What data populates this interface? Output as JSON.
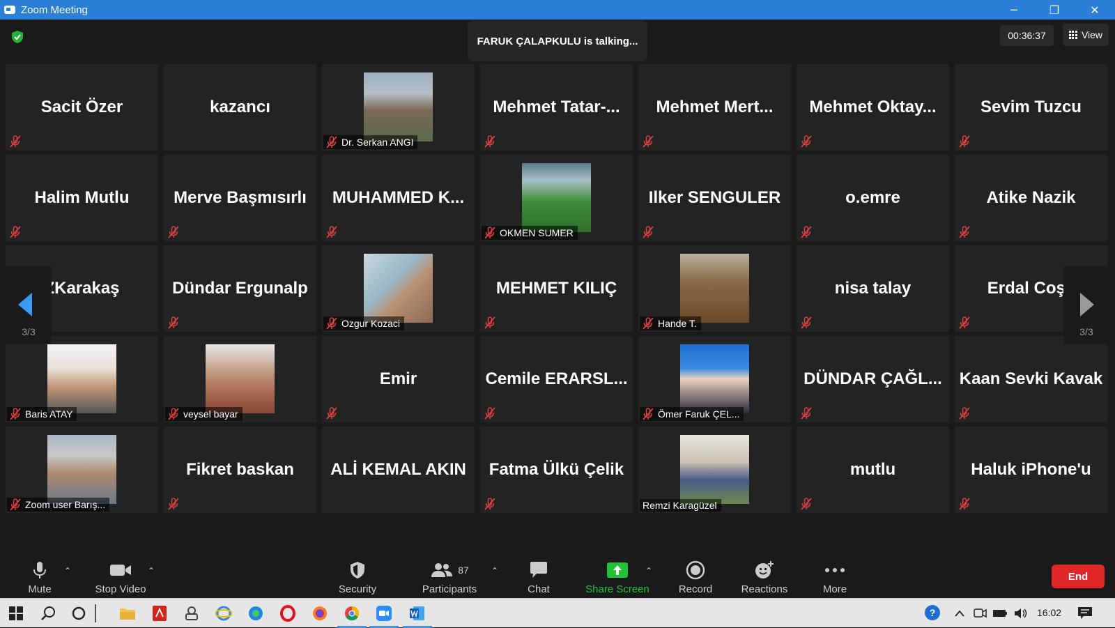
{
  "window": {
    "title": "Zoom Meeting",
    "minimize": "─",
    "restore": "❐",
    "close": "✕"
  },
  "meeting": {
    "talking_banner": "FARUK ÇALAPKULU is talking...",
    "timer": "00:36:37",
    "view_label": "View"
  },
  "participants": [
    {
      "name": "Sacit Özer",
      "video": false
    },
    {
      "name": "kazancı",
      "video": false,
      "muted": false
    },
    {
      "name": "Dr. Serkan ANGI",
      "video": true,
      "photo": "cap-sunglasses"
    },
    {
      "name": "Mehmet  Tatar-...",
      "video": false
    },
    {
      "name": "Mehmet  Mert...",
      "video": false
    },
    {
      "name": "Mehmet  Oktay...",
      "video": false
    },
    {
      "name": "Sevim Tuzcu",
      "video": false
    },
    {
      "name": "Halim Mutlu",
      "video": false
    },
    {
      "name": "Merve Başmısırlı",
      "video": false
    },
    {
      "name": "MUHAMMED  K...",
      "video": false
    },
    {
      "name": "OKMEN SUMER",
      "video": true,
      "photo": "outdoor-green"
    },
    {
      "name": "Ilker SENGULER",
      "video": false
    },
    {
      "name": "o.emre",
      "video": false
    },
    {
      "name": "Atike Nazik",
      "video": false
    },
    {
      "name": "ZKarakaş",
      "video": false
    },
    {
      "name": "Dündar Ergunalp",
      "video": false
    },
    {
      "name": "Ozgur Kozaci",
      "video": true,
      "photo": "man-map"
    },
    {
      "name": "MEHMET KILIÇ",
      "video": false
    },
    {
      "name": "Hande T.",
      "video": true,
      "photo": "curly-hair"
    },
    {
      "name": "nisa talay",
      "video": false
    },
    {
      "name": "Erdal Coşk",
      "video": false
    },
    {
      "name": "Baris ATAY",
      "video": true,
      "photo": "man-smile"
    },
    {
      "name": "veysel bayar",
      "video": true,
      "photo": "man-beard"
    },
    {
      "name": "Emir",
      "video": false
    },
    {
      "name": "Cemile  ERARSL...",
      "video": false
    },
    {
      "name": "Ömer Faruk ÇEL...",
      "video": true,
      "photo": "man-suit"
    },
    {
      "name": "DÜNDAR  ÇAĞL...",
      "video": false
    },
    {
      "name": "Kaan Sevki Kavak",
      "video": false
    },
    {
      "name": "Zoom user Barış...",
      "video": true,
      "photo": "man-beach"
    },
    {
      "name": "Fikret baskan",
      "video": false
    },
    {
      "name": "ALİ KEMAL AKIN",
      "video": false,
      "muted": false
    },
    {
      "name": "Fatma Ülkü Çelik",
      "video": false
    },
    {
      "name": "Remzi Karagüzel",
      "video": true,
      "photo": "man-room",
      "muted": false
    },
    {
      "name": "mutlu",
      "video": false
    },
    {
      "name": "Haluk iPhone'u",
      "video": false
    }
  ],
  "pager": {
    "left": "3/3",
    "right": "3/3"
  },
  "toolbar": {
    "mute": "Mute",
    "stop_video": "Stop Video",
    "security": "Security",
    "participants": "Participants",
    "participants_count": "87",
    "chat": "Chat",
    "share_screen": "Share Screen",
    "record": "Record",
    "reactions": "Reactions",
    "more": "More",
    "end": "End"
  },
  "taskbar": {
    "clock": "16:02"
  },
  "colors": {
    "titlebar": "#2b7fd6",
    "accent_green": "#23c23a",
    "end_red": "#e02828",
    "mute_red": "#e04040"
  }
}
